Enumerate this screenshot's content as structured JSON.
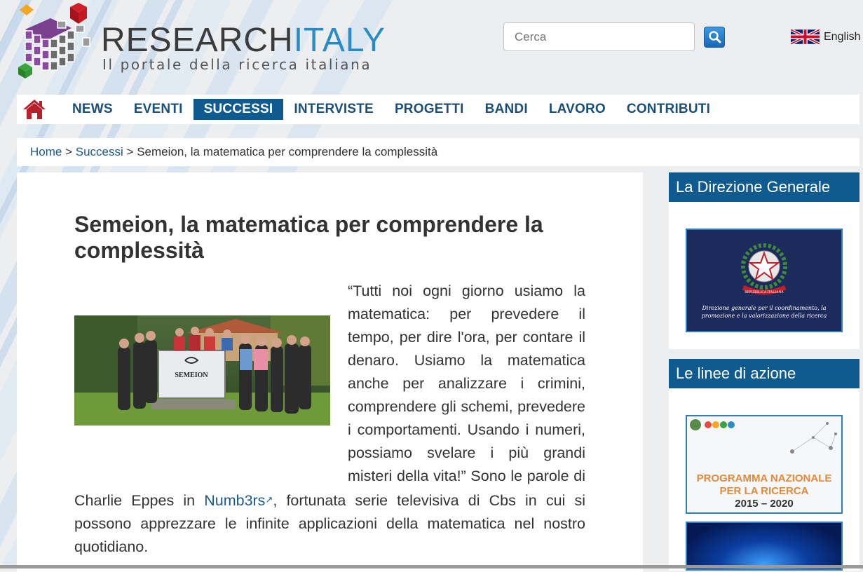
{
  "logo": {
    "title_main": "RESEARCH",
    "title_accent": "ITALY",
    "subtitle": "Il portale della ricerca italiana"
  },
  "search": {
    "placeholder": "Cerca"
  },
  "language": {
    "label": "English"
  },
  "nav": {
    "items": [
      "NEWS",
      "EVENTI",
      "SUCCESSI",
      "INTERVISTE",
      "PROGETTI",
      "BANDI",
      "LAVORO",
      "CONTRIBUTI"
    ],
    "active": "SUCCESSI"
  },
  "breadcrumb": {
    "home": "Home",
    "sep": ">",
    "section": "Successi",
    "current": "Semeion, la matematica per comprendere la complessità"
  },
  "article": {
    "title": "Semeion, la matematica per comprendere la complessità",
    "photo_sign": "SEMEION",
    "text_before_link": "“Tutti noi ogni giorno usiamo la matematica: per prevedere il tempo, per dire l'ora, per contare il denaro. Usiamo la matematica anche per analizzare i crimini, comprendere gli schemi, prevedere i comportamenti. Usando i numeri, possiamo svelare i più grandi misteri della vita!” Sono le parole di Charlie Eppes in ",
    "link_text": "Numb3rs",
    "text_after_link": ", fortunata serie televisiva di Cbs in cui si possono apprezzare le infinite applicazioni della matematica nel nostro quotidiano."
  },
  "sidebar": {
    "section1_title": "La Direzione Generale",
    "banner1_caption": "Direzione generale per il coordinamento, la promozione e la valorizzazione della ricerca",
    "banner1_seal_text": "REPUBBLICA ITALIANA",
    "section2_title": "Le linee di azione",
    "banner2_title_line1": "PROGRAMMA NAZIONALE",
    "banner2_title_line2": "PER LA RICERCA",
    "banner2_years": "2015 – 2020"
  },
  "colors": {
    "nav_active": "#0f5a8f",
    "link": "#1a5a8a",
    "sidebar_header": "#0f5a8f",
    "logo_accent": "#2a8cc7"
  }
}
